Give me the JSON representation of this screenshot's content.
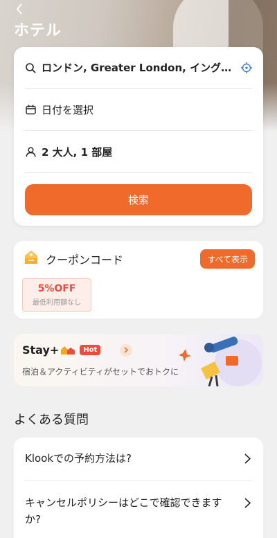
{
  "header": {
    "title": "ホテル"
  },
  "search": {
    "location": "ロンドン, Greater London, イングランド",
    "date_placeholder": "日付を選択",
    "guests": "2 大人, 1 部屋",
    "search_button": "検索"
  },
  "coupon": {
    "title": "クーポンコード",
    "view_all": "すべて表示",
    "ticket": {
      "amount": "5%OFF",
      "condition": "最低利用額なし"
    }
  },
  "promo": {
    "brand": "Stay+",
    "badge": "Hot",
    "subtitle": "宿泊＆アクティビティがセットでおトクに"
  },
  "faq": {
    "heading": "よくある質問",
    "items": [
      {
        "question": "Klookでの予約方法は?"
      },
      {
        "question": "キャンセルポリシーはどこで確認できますか?"
      }
    ]
  },
  "colors": {
    "accent": "#ef6a2b",
    "hot": "#ef4a3a",
    "locate": "#3a7bd5"
  },
  "icons": [
    "back-arrow-icon",
    "search-icon",
    "locate-icon",
    "calendar-icon",
    "person-icon",
    "coupon-tag-icon",
    "chevron-right-icon"
  ]
}
